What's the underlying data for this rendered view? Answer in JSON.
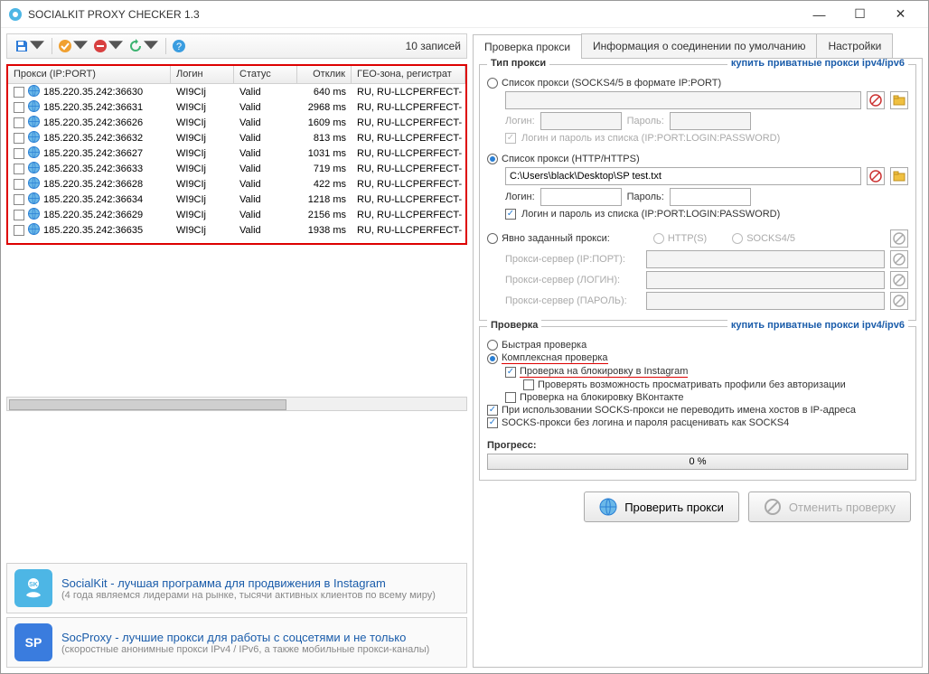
{
  "window": {
    "title": "SOCIALKIT PROXY CHECKER 1.3"
  },
  "toolbar": {
    "records": "10 записей"
  },
  "grid": {
    "headers": [
      "Прокси (IP:PORT)",
      "Логин",
      "Статус",
      "Отклик",
      "ГЕО-зона, регистрат"
    ],
    "rows": [
      {
        "proxy": "185.220.35.242:36630",
        "login": "WI9CIj",
        "status": "Valid",
        "response": "640 ms",
        "geo": "RU, RU-LLCPERFECT-"
      },
      {
        "proxy": "185.220.35.242:36631",
        "login": "WI9CIj",
        "status": "Valid",
        "response": "2968 ms",
        "geo": "RU, RU-LLCPERFECT-"
      },
      {
        "proxy": "185.220.35.242:36626",
        "login": "WI9CIj",
        "status": "Valid",
        "response": "1609 ms",
        "geo": "RU, RU-LLCPERFECT-"
      },
      {
        "proxy": "185.220.35.242:36632",
        "login": "WI9CIj",
        "status": "Valid",
        "response": "813 ms",
        "geo": "RU, RU-LLCPERFECT-"
      },
      {
        "proxy": "185.220.35.242:36627",
        "login": "WI9CIj",
        "status": "Valid",
        "response": "1031 ms",
        "geo": "RU, RU-LLCPERFECT-"
      },
      {
        "proxy": "185.220.35.242:36633",
        "login": "WI9CIj",
        "status": "Valid",
        "response": "719 ms",
        "geo": "RU, RU-LLCPERFECT-"
      },
      {
        "proxy": "185.220.35.242:36628",
        "login": "WI9CIj",
        "status": "Valid",
        "response": "422 ms",
        "geo": "RU, RU-LLCPERFECT-"
      },
      {
        "proxy": "185.220.35.242:36634",
        "login": "WI9CIj",
        "status": "Valid",
        "response": "1218 ms",
        "geo": "RU, RU-LLCPERFECT-"
      },
      {
        "proxy": "185.220.35.242:36629",
        "login": "WI9CIj",
        "status": "Valid",
        "response": "2156 ms",
        "geo": "RU, RU-LLCPERFECT-"
      },
      {
        "proxy": "185.220.35.242:36635",
        "login": "WI9CIj",
        "status": "Valid",
        "response": "1938 ms",
        "geo": "RU, RU-LLCPERFECT-"
      }
    ]
  },
  "promo1": {
    "title": "SocialKit - лучшая программа для продвижения в Instagram",
    "sub": "(4 года являемся лидерами на рынке, тысячи активных клиентов по всему миру)"
  },
  "promo2": {
    "title": "SocProxy - лучшие прокси для работы с соцсетями и не только",
    "sub": "(скоростные анонимные прокси IPv4 / IPv6, а также мобильные прокси-каналы)"
  },
  "tabs": [
    "Проверка прокси",
    "Информация о соединении по умолчанию",
    "Настройки"
  ],
  "group1": {
    "title": "Тип прокси",
    "link": "купить приватные прокси ipv4/ipv6",
    "radio_socks": "Список прокси (SOCKS4/5 в формате IP:PORT)",
    "login": "Логин:",
    "password": "Пароль:",
    "from_list": "Логин и пароль из списка (IP:PORT:LOGIN:PASSWORD)",
    "radio_http": "Список прокси (HTTP/HTTPS)",
    "file": "C:\\Users\\black\\Desktop\\SP test.txt",
    "radio_explicit": "Явно заданный прокси:",
    "http_s": "HTTP(S)",
    "socks45": "SOCKS4/5",
    "server_ip": "Прокси-сервер (IP:ПОРТ):",
    "server_login": "Прокси-сервер (ЛОГИН):",
    "server_pass": "Прокси-сервер (ПАРОЛЬ):"
  },
  "group2": {
    "title": "Проверка",
    "link": "купить приватные прокси ipv4/ipv6",
    "quick": "Быстрая проверка",
    "complex": "Комплексная проверка",
    "insta": "Проверка на блокировку в Instagram",
    "profiles": "Проверять возможность просматривать профили без авторизации",
    "vk": "Проверка на блокировку ВКонтакте",
    "hosts": "При использовании SOCKS-прокси не переводить имена хостов в IP-адреса",
    "nologin": "SOCKS-прокси без логина и пароля расценивать как SOCKS4",
    "progress": "Прогресс:",
    "progress_val": "0 %"
  },
  "buttons": {
    "check": "Проверить прокси",
    "cancel": "Отменить проверку"
  }
}
